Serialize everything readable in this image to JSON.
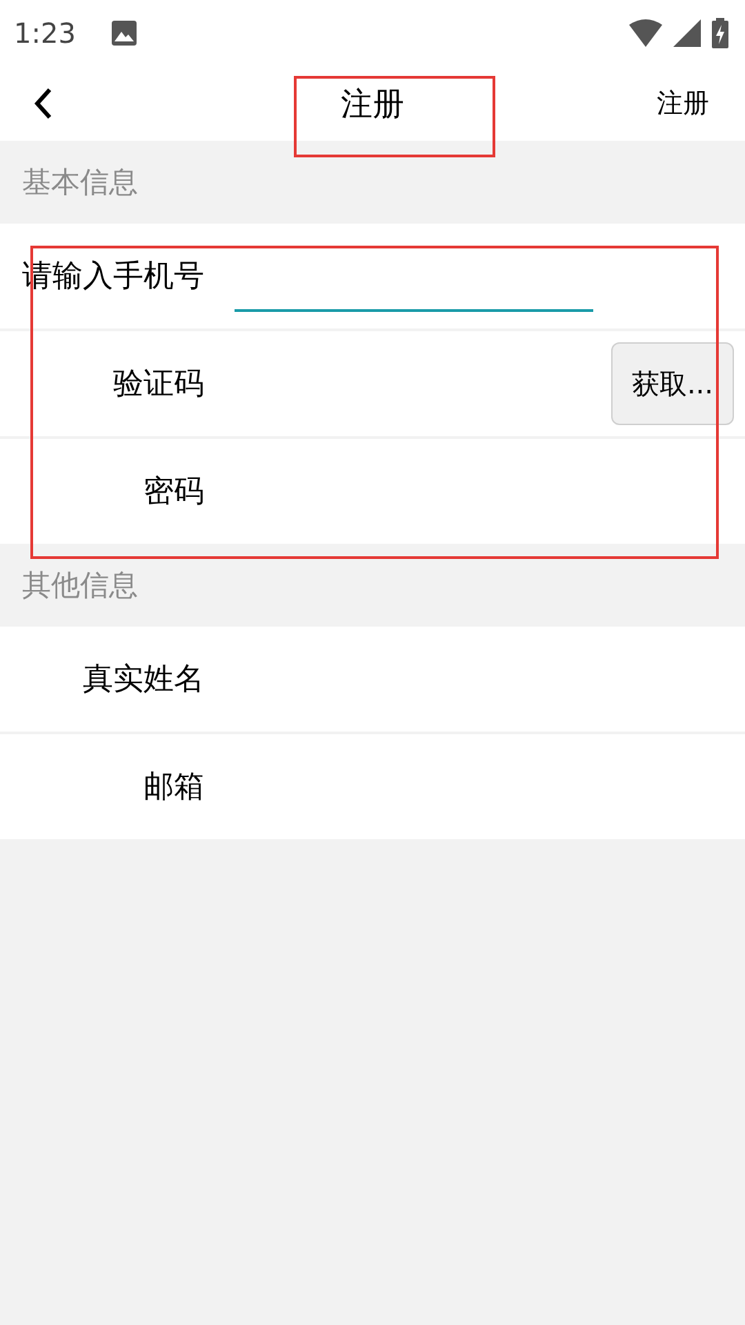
{
  "status_bar": {
    "time": "1:23"
  },
  "app_bar": {
    "title": "注册",
    "action": "注册"
  },
  "sections": [
    {
      "title": "基本信息",
      "fields": [
        {
          "kind": "text",
          "label": "请输入手机号",
          "focused": true
        },
        {
          "kind": "code",
          "label": "验证码",
          "focused": false,
          "button": "获取..."
        },
        {
          "kind": "text",
          "label": "密码",
          "focused": false
        }
      ]
    },
    {
      "title": "其他信息",
      "fields": [
        {
          "kind": "text",
          "label": "真实姓名",
          "focused": false
        },
        {
          "kind": "text",
          "label": "邮箱",
          "focused": false
        }
      ]
    }
  ]
}
